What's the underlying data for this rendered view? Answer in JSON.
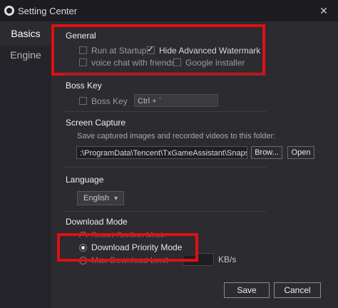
{
  "window": {
    "title": "Setting Center"
  },
  "sidebar": {
    "tabs": [
      {
        "label": "Basics",
        "active": true
      },
      {
        "label": "Engine",
        "active": false
      }
    ]
  },
  "general": {
    "title": "General",
    "options": [
      {
        "label": "Run at Startup",
        "checked": false
      },
      {
        "label": "Hide Advanced Watermark",
        "checked": true
      },
      {
        "label": "voice chat with friends",
        "checked": false
      },
      {
        "label": "Google installer",
        "checked": false
      }
    ]
  },
  "boss_key": {
    "title": "Boss Key",
    "checkbox_label": "Boss Key",
    "checked": false,
    "shortcut": "Ctrl + `"
  },
  "screen_capture": {
    "title": "Screen Capture",
    "description": "Save captured images and recorded videos to this folder:",
    "path": ":\\ProgramData\\Tencent\\TxGameAssistant\\Snapshot",
    "browse_label": "Brow...",
    "open_label": "Open"
  },
  "language": {
    "title": "Language",
    "selected": "English"
  },
  "download_mode": {
    "title": "Download Mode",
    "options": [
      {
        "label": "Smart Surfing Mode",
        "selected": false
      },
      {
        "label": "Download Priority Mode",
        "selected": true
      },
      {
        "label": "Max Download Limit",
        "selected": false
      }
    ],
    "unit": "KB/s"
  },
  "footer": {
    "save_label": "Save",
    "cancel_label": "Cancel"
  },
  "colors": {
    "highlight": "#e01010",
    "background": "#2b2b30",
    "sidebar": "#24242a"
  }
}
